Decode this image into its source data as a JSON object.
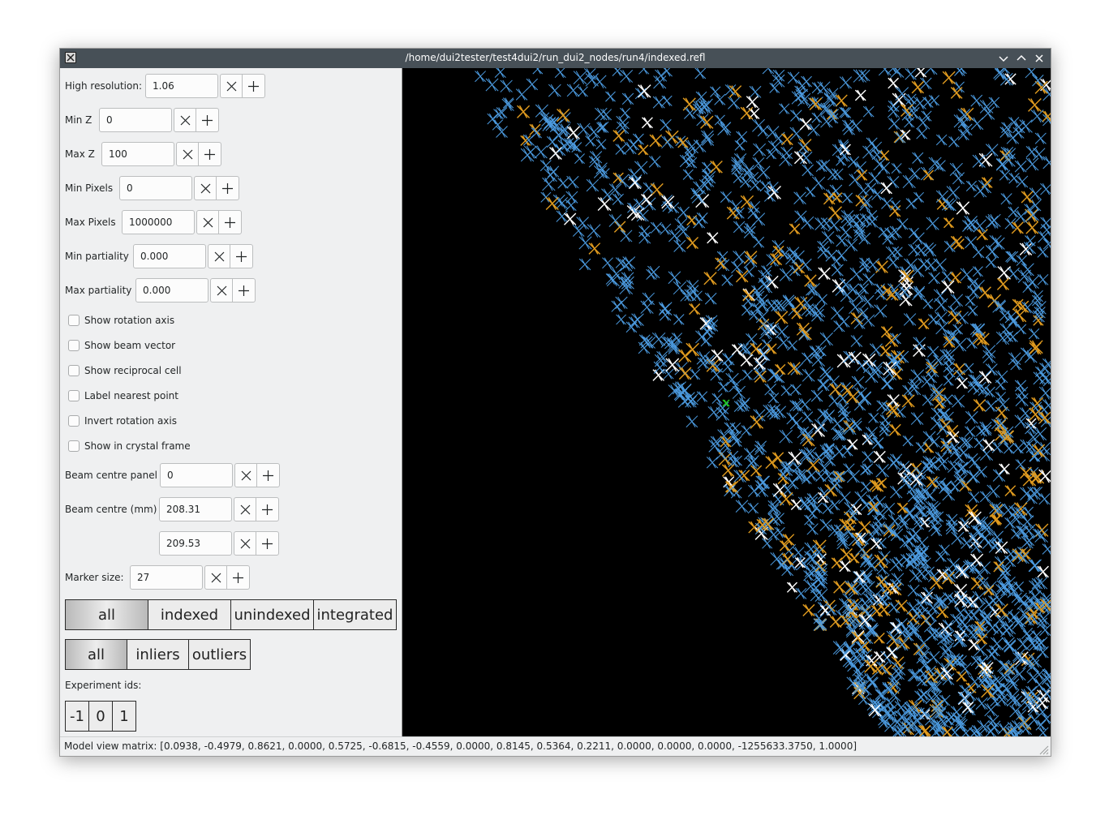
{
  "window": {
    "title": "/home/dui2tester/test4dui2/run_dui2_nodes/run4/indexed.refl",
    "app_icon": "x11-window-icon",
    "buttons": [
      "minimize-icon",
      "maximize-icon",
      "close-icon"
    ]
  },
  "controls": {
    "high_resolution": {
      "label": "High resolution:",
      "value": "1.06"
    },
    "min_z": {
      "label": "Min Z",
      "value": "0"
    },
    "max_z": {
      "label": "Max Z",
      "value": "100"
    },
    "min_pixels": {
      "label": "Min Pixels",
      "value": "0"
    },
    "max_pixels": {
      "label": "Max Pixels",
      "value": "1000000"
    },
    "min_partiality": {
      "label": "Min partiality",
      "value": "0.000"
    },
    "max_partiality": {
      "label": "Max partiality",
      "value": "0.000"
    },
    "beam_centre_panel": {
      "label": "Beam centre panel",
      "value": "0"
    },
    "beam_centre_mm": {
      "label": "Beam centre (mm)",
      "x": "208.31",
      "y": "209.53"
    },
    "marker_size": {
      "label": "Marker size:",
      "value": "27"
    }
  },
  "checkboxes": {
    "show_rotation_axis": {
      "label": "Show rotation axis",
      "checked": false
    },
    "show_beam_vector": {
      "label": "Show beam vector",
      "checked": false
    },
    "show_reciprocal_cell": {
      "label": "Show reciprocal cell",
      "checked": false
    },
    "label_nearest_point": {
      "label": "Label nearest point",
      "checked": false
    },
    "invert_rotation_axis": {
      "label": "Invert rotation axis",
      "checked": false
    },
    "show_in_crystal_frame": {
      "label": "Show in crystal frame",
      "checked": false
    }
  },
  "filter_reflections": {
    "options": [
      "all",
      "indexed",
      "unindexed",
      "integrated"
    ],
    "selected": "all"
  },
  "filter_outliers": {
    "options": [
      "all",
      "inliers",
      "outliers"
    ],
    "selected": "all"
  },
  "experiment_ids": {
    "label": "Experiment ids:",
    "options": [
      "-1",
      "0",
      "1"
    ]
  },
  "viewer": {
    "background": "#000000",
    "marker_colors": {
      "indexed_blue": "#4c9be0",
      "orange": "#e09b1f",
      "white": "#ffffff",
      "green": "#22cc22"
    }
  },
  "status": {
    "text": "Model view matrix: [0.0938, -0.4979, 0.8621, 0.0000, 0.5725, -0.6815, -0.4559, 0.0000, 0.8145, 0.5364, 0.2211, 0.0000, 0.0000, 0.0000, -1255633.3750, 1.0000]"
  }
}
